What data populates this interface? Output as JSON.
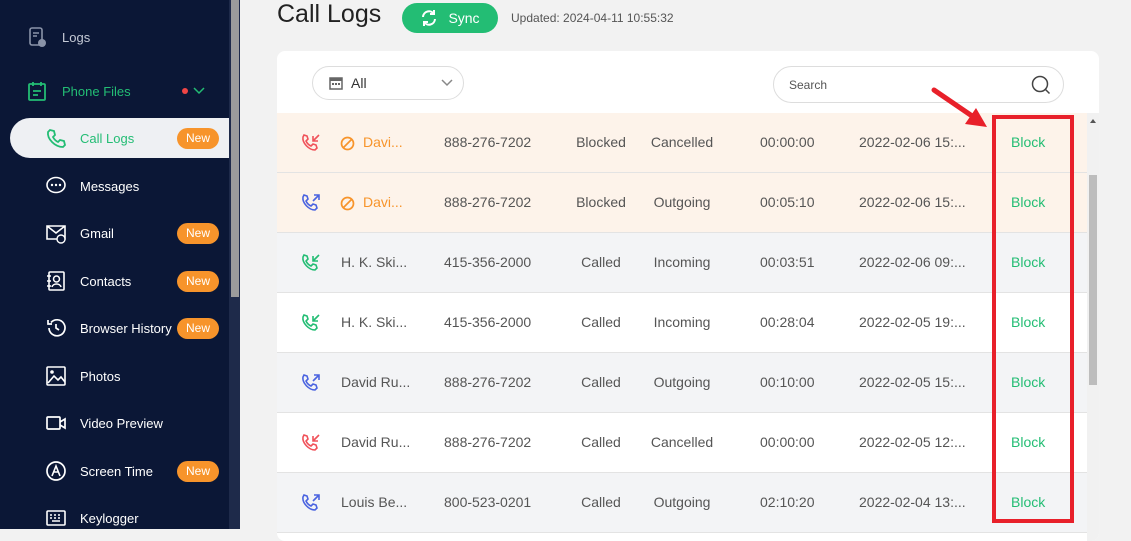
{
  "sidebar": {
    "items": [
      {
        "label": "Logs",
        "icon": "logs-icon"
      },
      {
        "label": "Phone Files",
        "icon": "phone-files-icon"
      },
      {
        "label": "Call Logs",
        "icon": "phone-icon",
        "badge": "New"
      },
      {
        "label": "Messages",
        "icon": "message-icon"
      },
      {
        "label": "Gmail",
        "icon": "gmail-icon",
        "badge": "New"
      },
      {
        "label": "Contacts",
        "icon": "contacts-icon",
        "badge": "New"
      },
      {
        "label": "Browser History",
        "icon": "history-icon",
        "badge": "New"
      },
      {
        "label": "Photos",
        "icon": "photo-icon"
      },
      {
        "label": "Video Preview",
        "icon": "video-icon"
      },
      {
        "label": "Screen Time",
        "icon": "screen-time-icon",
        "badge": "New"
      },
      {
        "label": "Keylogger",
        "icon": "keyboard-icon"
      }
    ]
  },
  "header": {
    "title": "Call Logs",
    "sync_label": "Sync",
    "updated": "Updated: 2024-04-11 10:55:32"
  },
  "filter": {
    "value": "All"
  },
  "search": {
    "placeholder": "Search"
  },
  "colors": {
    "accent": "#23bd74",
    "badge": "#f7942b",
    "blocked": "#f7942b",
    "annotation": "#e8202a"
  },
  "rows": [
    {
      "dir": "incoming-missed",
      "blocked": true,
      "name": "Davi...",
      "phone": "888-276-7202",
      "status": "Blocked",
      "type": "Cancelled",
      "duration": "00:00:00",
      "date": "2022-02-06 15:...",
      "action": "Block"
    },
    {
      "dir": "outgoing",
      "blocked": true,
      "name": "Davi...",
      "phone": "888-276-7202",
      "status": "Blocked",
      "type": "Outgoing",
      "duration": "00:05:10",
      "date": "2022-02-06 15:...",
      "action": "Block"
    },
    {
      "dir": "incoming",
      "blocked": false,
      "name": "H. K. Ski...",
      "phone": "415-356-2000",
      "status": "Called",
      "type": "Incoming",
      "duration": "00:03:51",
      "date": "2022-02-06 09:...",
      "action": "Block"
    },
    {
      "dir": "incoming",
      "blocked": false,
      "name": "H. K. Ski...",
      "phone": "415-356-2000",
      "status": "Called",
      "type": "Incoming",
      "duration": "00:28:04",
      "date": "2022-02-05 19:...",
      "action": "Block"
    },
    {
      "dir": "outgoing",
      "blocked": false,
      "name": "David Ru...",
      "phone": "888-276-7202",
      "status": "Called",
      "type": "Outgoing",
      "duration": "00:10:00",
      "date": "2022-02-05 15:...",
      "action": "Block"
    },
    {
      "dir": "incoming-missed",
      "blocked": false,
      "name": "David Ru...",
      "phone": "888-276-7202",
      "status": "Called",
      "type": "Cancelled",
      "duration": "00:00:00",
      "date": "2022-02-05 12:...",
      "action": "Block"
    },
    {
      "dir": "outgoing",
      "blocked": false,
      "name": "Louis Be...",
      "phone": "800-523-0201",
      "status": "Called",
      "type": "Outgoing",
      "duration": "02:10:20",
      "date": "2022-02-04 13:...",
      "action": "Block"
    }
  ]
}
